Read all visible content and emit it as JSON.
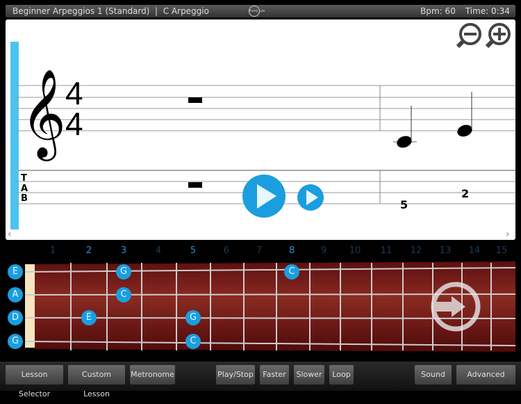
{
  "header": {
    "title": "Beginner Arpeggios 1 (Standard)  |  C Arpeggio",
    "logo": "Purely Lute",
    "bpm": "Bpm: 60",
    "time": "Time: 0:34"
  },
  "score": {
    "time_signature": [
      "4",
      "4"
    ],
    "tab_label": [
      "T",
      "A",
      "B"
    ],
    "tab_numbers": [
      "5",
      "2"
    ],
    "icons": [
      "zoom-out-icon",
      "zoom-in-icon",
      "play-icon",
      "play-small-icon",
      "chevron-left-icon",
      "chevron-right-icon"
    ],
    "accent": "#1a9ee0"
  },
  "fretboard": {
    "fret_numbers": [
      "1",
      "2",
      "3",
      "4",
      "5",
      "6",
      "7",
      "8",
      "9",
      "10",
      "11",
      "12",
      "13",
      "14",
      "15"
    ],
    "highlighted_frets": [
      "2",
      "3",
      "5",
      "8"
    ],
    "strings": [
      "E",
      "A",
      "D",
      "G"
    ],
    "notes": [
      {
        "string": "E",
        "fret": 3,
        "note": "G"
      },
      {
        "string": "E",
        "fret": 8,
        "note": "C"
      },
      {
        "string": "A",
        "fret": 3,
        "note": "C"
      },
      {
        "string": "D",
        "fret": 2,
        "note": "E"
      },
      {
        "string": "D",
        "fret": 5,
        "note": "G"
      },
      {
        "string": "G",
        "fret": 5,
        "note": "C"
      }
    ],
    "board_color": "#7a1a1a"
  },
  "toolbar": {
    "lesson_selector": "Lesson Selector",
    "custom_lesson": "Custom Lesson",
    "metronome": "Metronome",
    "play_stop": "Play/Stop",
    "faster": "Faster",
    "slower": "Slower",
    "loop": "Loop",
    "sound": "Sound",
    "advanced": "Advanced"
  }
}
